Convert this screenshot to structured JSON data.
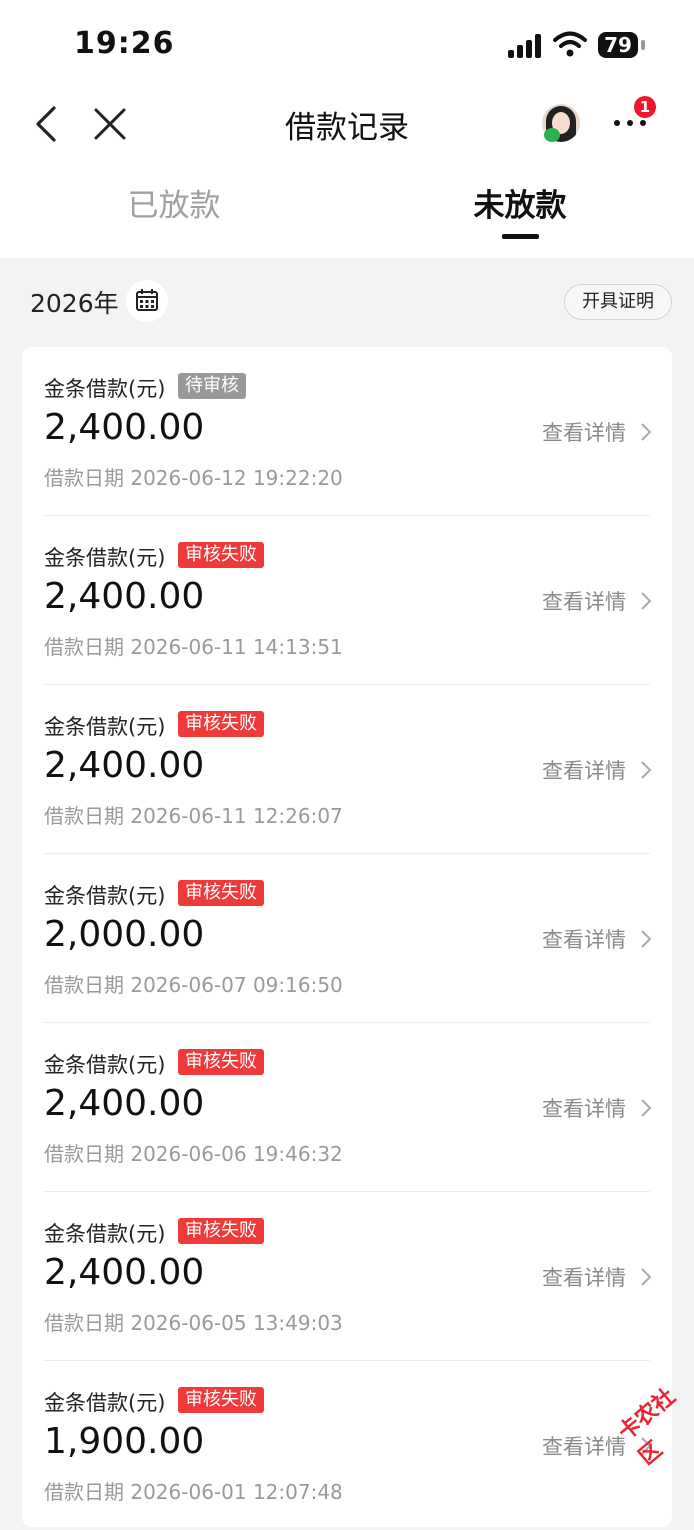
{
  "status_bar": {
    "time": "19:26",
    "battery": "79"
  },
  "nav": {
    "title": "借款记录",
    "badge_count": "1"
  },
  "tabs": [
    {
      "label": "已放款",
      "active": false
    },
    {
      "label": "未放款",
      "active": true
    }
  ],
  "filter": {
    "year": "2026年",
    "certificate_label": "开具证明"
  },
  "loans": [
    {
      "title": "金条借款(元)",
      "status": "待审核",
      "status_type": "pending",
      "amount": "2,400.00",
      "date": "借款日期 2026-06-12 19:22:20",
      "detail_label": "查看详情"
    },
    {
      "title": "金条借款(元)",
      "status": "审核失败",
      "status_type": "fail",
      "amount": "2,400.00",
      "date": "借款日期 2026-06-11 14:13:51",
      "detail_label": "查看详情"
    },
    {
      "title": "金条借款(元)",
      "status": "审核失败",
      "status_type": "fail",
      "amount": "2,400.00",
      "date": "借款日期 2026-06-11 12:26:07",
      "detail_label": "查看详情"
    },
    {
      "title": "金条借款(元)",
      "status": "审核失败",
      "status_type": "fail",
      "amount": "2,000.00",
      "date": "借款日期 2026-06-07 09:16:50",
      "detail_label": "查看详情"
    },
    {
      "title": "金条借款(元)",
      "status": "审核失败",
      "status_type": "fail",
      "amount": "2,400.00",
      "date": "借款日期 2026-06-06 19:46:32",
      "detail_label": "查看详情"
    },
    {
      "title": "金条借款(元)",
      "status": "审核失败",
      "status_type": "fail",
      "amount": "2,400.00",
      "date": "借款日期 2026-06-05 13:49:03",
      "detail_label": "查看详情"
    },
    {
      "title": "金条借款(元)",
      "status": "审核失败",
      "status_type": "fail",
      "amount": "1,900.00",
      "date": "借款日期 2026-06-01 12:07:48",
      "detail_label": "查看详情"
    }
  ],
  "watermark": "卡农社区",
  "colors": {
    "fail_tag": "#f03a3a",
    "pending_tag": "#999999",
    "badge": "#f2152d"
  }
}
